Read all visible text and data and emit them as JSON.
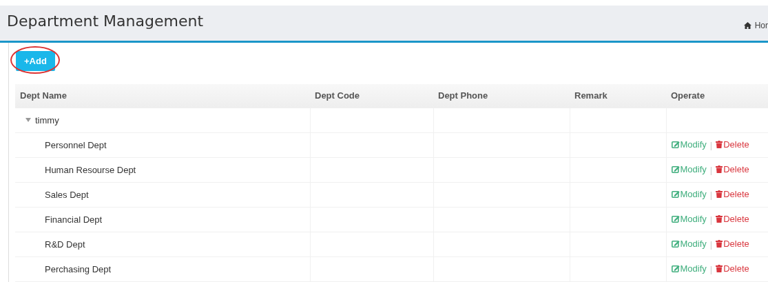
{
  "page_title": "Department Management",
  "breadcrumb": {
    "label": "Hor"
  },
  "add_button": {
    "label": "+Add",
    "highlighted": true
  },
  "table": {
    "columns": [
      "Dept Name",
      "Dept Code",
      "Dept Phone",
      "Remark",
      "Operate"
    ],
    "rows": [
      {
        "name": "timmy",
        "expanded": true,
        "children": [
          {
            "name": "Personnel Dept",
            "actions": [
              {
                "kind": "modify",
                "label": "Modify"
              },
              {
                "kind": "delete",
                "label": "Delete"
              }
            ],
            "separator": "|"
          },
          {
            "name": "Human Resourse Dept",
            "actions": [
              {
                "kind": "modify",
                "label": "Modify"
              },
              {
                "kind": "delete",
                "label": "Delete"
              }
            ],
            "separator": "|"
          },
          {
            "name": "Sales Dept",
            "actions": [
              {
                "kind": "modify",
                "label": "Modify"
              },
              {
                "kind": "delete",
                "label": "Delete"
              }
            ],
            "separator": "|"
          },
          {
            "name": "Financial Dept",
            "actions": [
              {
                "kind": "modify",
                "label": "Modify"
              },
              {
                "kind": "delete",
                "label": "Delete"
              }
            ],
            "separator": "|"
          },
          {
            "name": "R&D Dept",
            "actions": [
              {
                "kind": "modify",
                "label": "Modify"
              },
              {
                "kind": "delete",
                "label": "Delete"
              }
            ],
            "separator": "|"
          },
          {
            "name": "Perchasing Dept",
            "actions": [
              {
                "kind": "modify",
                "label": "Modify"
              },
              {
                "kind": "delete",
                "label": "Delete"
              }
            ],
            "separator": "|"
          }
        ]
      }
    ]
  }
}
